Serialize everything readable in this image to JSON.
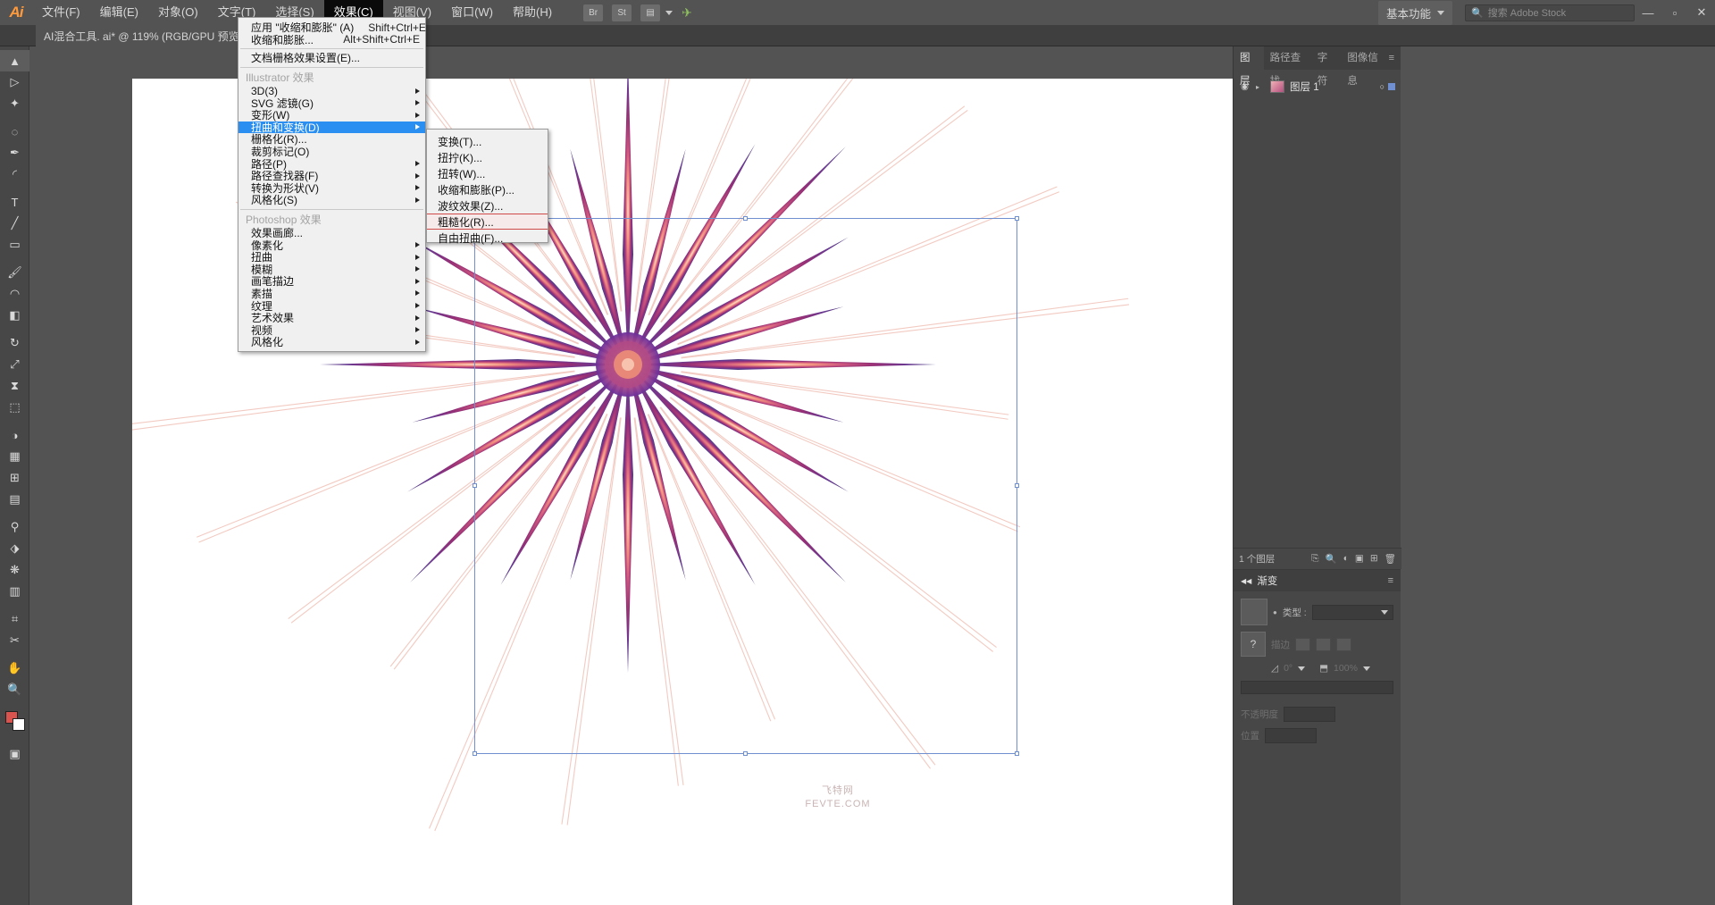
{
  "app": {
    "name": "Adobe Illustrator",
    "logo": "Ai"
  },
  "menubar": {
    "items": [
      {
        "label": "文件(F)",
        "active": false
      },
      {
        "label": "编辑(E)",
        "active": false
      },
      {
        "label": "对象(O)",
        "active": false
      },
      {
        "label": "文字(T)",
        "active": false
      },
      {
        "label": "选择(S)",
        "active": false
      },
      {
        "label": "效果(C)",
        "active": true
      },
      {
        "label": "视图(V)",
        "active": false
      },
      {
        "label": "窗口(W)",
        "active": false
      },
      {
        "label": "帮助(H)",
        "active": false
      }
    ],
    "bridge_button": "Br",
    "stock_button": "St",
    "workspace": "基本功能",
    "search_placeholder": "搜索 Adobe Stock",
    "minimize": "—",
    "maximize": "▫",
    "close": "✕"
  },
  "document_tab": {
    "title": "AI混合工具. ai* @ 119% (RGB/GPU 预览)",
    "close": "✕"
  },
  "toolbar": {
    "tools": [
      {
        "name": "selection-tool",
        "glyph": "▲"
      },
      {
        "name": "direct-selection-tool",
        "glyph": "▷"
      },
      {
        "name": "magic-wand-tool",
        "glyph": "✦"
      },
      {
        "name": "lasso-tool",
        "glyph": "◌"
      },
      {
        "name": "pen-tool",
        "glyph": "✒"
      },
      {
        "name": "curvature-tool",
        "glyph": "◜"
      },
      {
        "name": "type-tool",
        "glyph": "T"
      },
      {
        "name": "line-segment-tool",
        "glyph": "╱"
      },
      {
        "name": "rectangle-tool",
        "glyph": "▭"
      },
      {
        "name": "paintbrush-tool",
        "glyph": "🖌"
      },
      {
        "name": "shaper-tool",
        "glyph": "◠"
      },
      {
        "name": "eraser-tool",
        "glyph": "◧"
      },
      {
        "name": "rotate-tool",
        "glyph": "↻"
      },
      {
        "name": "scale-tool",
        "glyph": "⤢"
      },
      {
        "name": "width-tool",
        "glyph": "⧗"
      },
      {
        "name": "free-transform-tool",
        "glyph": "⬚"
      },
      {
        "name": "shape-builder-tool",
        "glyph": "◑"
      },
      {
        "name": "perspective-grid-tool",
        "glyph": "▦"
      },
      {
        "name": "mesh-tool",
        "glyph": "⊞"
      },
      {
        "name": "gradient-tool",
        "glyph": "▤"
      },
      {
        "name": "eyedropper-tool",
        "glyph": "⚲"
      },
      {
        "name": "blend-tool",
        "glyph": "⬗"
      },
      {
        "name": "symbol-sprayer-tool",
        "glyph": "❋"
      },
      {
        "name": "column-graph-tool",
        "glyph": "▥"
      },
      {
        "name": "artboard-tool",
        "glyph": "⌗"
      },
      {
        "name": "slice-tool",
        "glyph": "✂"
      },
      {
        "name": "hand-tool",
        "glyph": "✋"
      },
      {
        "name": "zoom-tool",
        "glyph": "🔍"
      }
    ],
    "fill_stroke_label": "fill-stroke-swatch",
    "screen_mode": "▣"
  },
  "effect_menu": {
    "groups": [
      {
        "type": "items",
        "items": [
          {
            "label": "应用 \"收缩和膨胀\" (A)",
            "shortcut": "Shift+Ctrl+E",
            "submenu": false,
            "disabled": false
          },
          {
            "label": "收缩和膨胀...",
            "shortcut": "Alt+Shift+Ctrl+E",
            "submenu": false,
            "disabled": false
          }
        ]
      },
      {
        "type": "separator"
      },
      {
        "type": "items",
        "items": [
          {
            "label": "文档栅格效果设置(E)...",
            "shortcut": "",
            "submenu": false,
            "disabled": false
          }
        ]
      },
      {
        "type": "separator"
      },
      {
        "type": "header",
        "label": "Illustrator 效果"
      },
      {
        "type": "items",
        "items": [
          {
            "label": "3D(3)",
            "shortcut": "",
            "submenu": true,
            "disabled": false
          },
          {
            "label": "SVG 滤镜(G)",
            "shortcut": "",
            "submenu": true,
            "disabled": false
          },
          {
            "label": "变形(W)",
            "shortcut": "",
            "submenu": true,
            "disabled": false
          },
          {
            "label": "扭曲和变换(D)",
            "shortcut": "",
            "submenu": true,
            "disabled": false,
            "selected": true
          },
          {
            "label": "栅格化(R)...",
            "shortcut": "",
            "submenu": false,
            "disabled": false
          },
          {
            "label": "裁剪标记(O)",
            "shortcut": "",
            "submenu": false,
            "disabled": false
          },
          {
            "label": "路径(P)",
            "shortcut": "",
            "submenu": true,
            "disabled": false
          },
          {
            "label": "路径查找器(F)",
            "shortcut": "",
            "submenu": true,
            "disabled": false
          },
          {
            "label": "转换为形状(V)",
            "shortcut": "",
            "submenu": true,
            "disabled": false
          },
          {
            "label": "风格化(S)",
            "shortcut": "",
            "submenu": true,
            "disabled": false
          }
        ]
      },
      {
        "type": "separator"
      },
      {
        "type": "header",
        "label": "Photoshop 效果"
      },
      {
        "type": "items",
        "items": [
          {
            "label": "效果画廊...",
            "shortcut": "",
            "submenu": false,
            "disabled": false
          },
          {
            "label": "像素化",
            "shortcut": "",
            "submenu": true,
            "disabled": false
          },
          {
            "label": "扭曲",
            "shortcut": "",
            "submenu": true,
            "disabled": false
          },
          {
            "label": "模糊",
            "shortcut": "",
            "submenu": true,
            "disabled": false
          },
          {
            "label": "画笔描边",
            "shortcut": "",
            "submenu": true,
            "disabled": false
          },
          {
            "label": "素描",
            "shortcut": "",
            "submenu": true,
            "disabled": false
          },
          {
            "label": "纹理",
            "shortcut": "",
            "submenu": true,
            "disabled": false
          },
          {
            "label": "艺术效果",
            "shortcut": "",
            "submenu": true,
            "disabled": false
          },
          {
            "label": "视频",
            "shortcut": "",
            "submenu": true,
            "disabled": false
          },
          {
            "label": "风格化",
            "shortcut": "",
            "submenu": true,
            "disabled": false
          }
        ]
      }
    ]
  },
  "distort_submenu": {
    "items": [
      {
        "label": "变换(T)...",
        "highlighted": false
      },
      {
        "label": "扭拧(K)...",
        "highlighted": false
      },
      {
        "label": "扭转(W)...",
        "highlighted": false
      },
      {
        "label": "收缩和膨胀(P)...",
        "highlighted": false
      },
      {
        "label": "波纹效果(Z)...",
        "highlighted": false
      },
      {
        "label": "粗糙化(R)...",
        "highlighted": true
      },
      {
        "label": "自由扭曲(F)...",
        "highlighted": false
      }
    ]
  },
  "layers_panel": {
    "tabs": [
      {
        "label": "图层",
        "active": true
      },
      {
        "label": "路径查找",
        "active": false
      },
      {
        "label": "字符",
        "active": false
      },
      {
        "label": "图像信息",
        "active": false
      }
    ],
    "menu_glyph": "≡",
    "rows": [
      {
        "eye": "◉",
        "expand": "▸",
        "name": "图层 1",
        "target": "○",
        "selected": true
      }
    ],
    "footer": {
      "count": "1 个图层",
      "icons": [
        "⎘",
        "🔍",
        "◐",
        "▣",
        "⊞",
        "🗑"
      ]
    }
  },
  "gradient_panel": {
    "title": "渐变",
    "menu_glyph": "≡",
    "type_label": "类型 :",
    "type_value": "",
    "stroke_label": "描边",
    "angle_label": "角度",
    "angle_value": "0°",
    "ratio_value": "100%",
    "opacity_label": "不透明度",
    "location_label": "位置",
    "help_glyph": "?"
  },
  "canvas": {
    "watermark_cn": "飞特网",
    "watermark_en": "FEVTE.COM",
    "zoom": "119%"
  },
  "colors": {
    "chrome": "#535353",
    "panel": "#474747",
    "menu_bg": "#f0f0f0",
    "menu_highlight": "#2a8ff0",
    "submenu_highlight_border": "#d04a4a",
    "selection_blue": "#6f8fd0",
    "art_magenta": "#8e1f6b",
    "art_coral": "#f2877a",
    "art_purple": "#5d2a8a"
  }
}
